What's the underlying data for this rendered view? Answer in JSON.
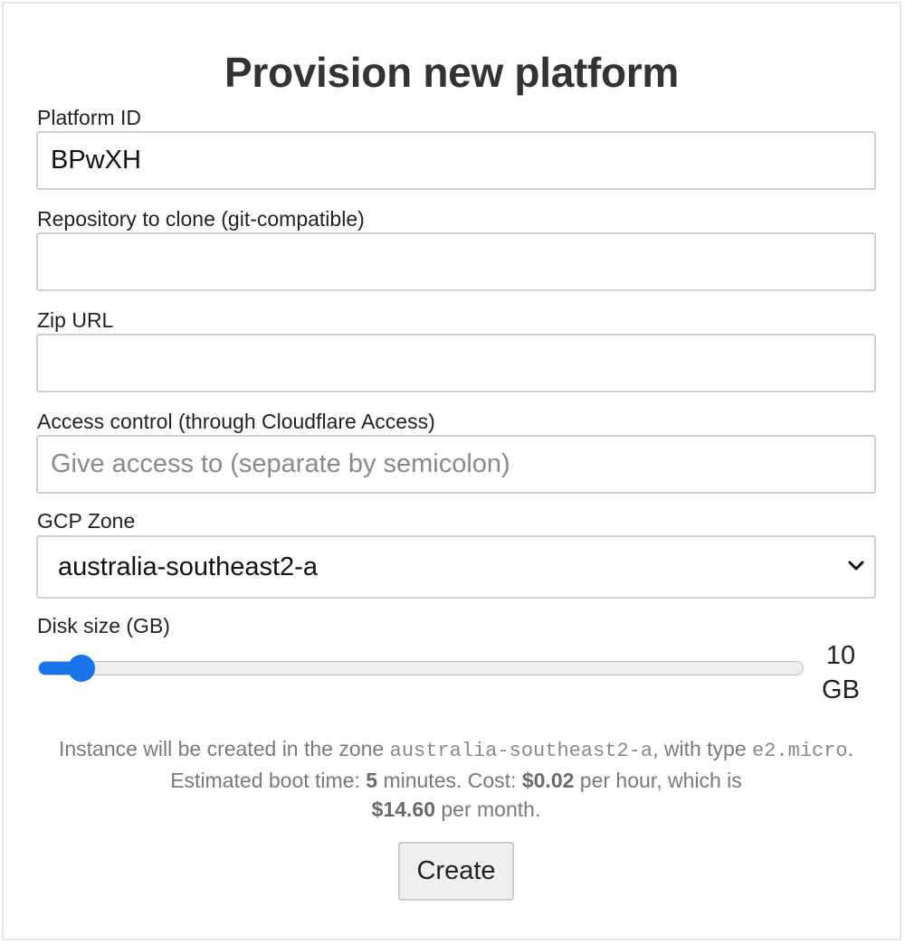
{
  "form": {
    "title": "Provision new platform",
    "platform_id": {
      "label": "Platform ID",
      "value": "BPwXH"
    },
    "repository": {
      "label": "Repository to clone (git-compatible)",
      "value": ""
    },
    "zip_url": {
      "label": "Zip URL",
      "value": ""
    },
    "access_control": {
      "label": "Access control (through Cloudflare Access)",
      "placeholder": "Give access to (separate by semicolon)",
      "value": ""
    },
    "gcp_zone": {
      "label": "GCP Zone",
      "selected": "australia-southeast2-a"
    },
    "disk_size": {
      "label": "Disk size (GB)",
      "value": 10,
      "unit": "GB",
      "fraction": 0.03
    },
    "info": {
      "part1": "Instance will be created in the zone ",
      "zone": "australia-southeast2-a",
      "part2": ", with type ",
      "machine_type": "e2.micro",
      "part3": ". Estimated boot time: ",
      "boot_time": "5",
      "part4": " minutes. Cost: ",
      "hourly_cost": "$0.02",
      "part5": " per hour, which is ",
      "monthly_cost": "$14.60",
      "part6": " per month."
    },
    "create_label": "Create"
  },
  "colors": {
    "accent": "#1a73e8",
    "title": "#333333",
    "muted_text": "#7a7a7a"
  }
}
